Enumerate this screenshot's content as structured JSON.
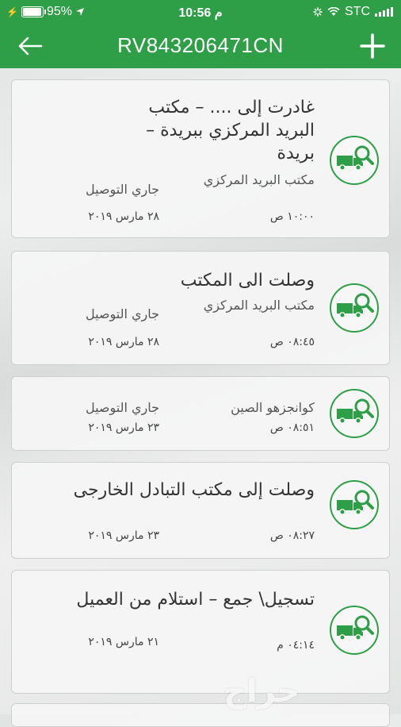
{
  "status_bar": {
    "battery_percent": "95%",
    "time": "10:56 م",
    "carrier": "STC",
    "battery_level": 0.95
  },
  "header": {
    "title": "RV843206471CN",
    "back_icon": "arrow-left-icon",
    "add_icon": "plus-icon"
  },
  "events": [
    {
      "status": "غادرت إلى .... – مكتب البريد المركزي ببريدة – بريدة",
      "office": "مكتب البريد المركزي",
      "delivery": "جاري التوصيل",
      "time": "١٠:٠٠ ص",
      "date": "٢٨ مارس ٢٠١٩"
    },
    {
      "status": "وصلت الى المكتب",
      "office": "مكتب البريد المركزي",
      "delivery": "جاري التوصيل",
      "time": "٠٨:٤٥ ص",
      "date": "٢٨ مارس ٢٠١٩"
    },
    {
      "status": "",
      "office": "كوانجزهو الصين",
      "delivery": "جاري التوصيل",
      "time": "٠٨:٥١ ص",
      "date": "٢٣ مارس ٢٠١٩"
    },
    {
      "status": "وصلت إلى مكتب التبادل الخارجى",
      "office": "",
      "delivery": "",
      "time": "٠٨:٢٧ ص",
      "date": "٢٣ مارس ٢٠١٩"
    },
    {
      "status": "تسجيل\\ جمع – استلام من العميل",
      "office": "",
      "delivery": "",
      "time": "٠٤:١٤ م",
      "date": "٢١ مارس ٢٠١٩"
    }
  ],
  "icons": {
    "event_icon": "truck-search-icon"
  },
  "colors": {
    "accent": "#2e9f46"
  },
  "watermark": "حراج"
}
